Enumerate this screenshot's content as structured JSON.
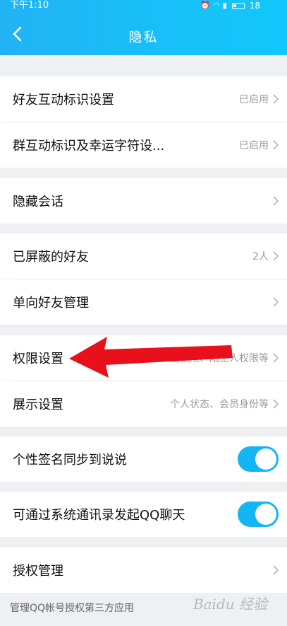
{
  "status_bar": {
    "time": "下午1:10",
    "battery": "18"
  },
  "header": {
    "title": "隐私"
  },
  "rows": [
    {
      "label": "好友互动标识设置",
      "value": "已启用"
    },
    {
      "label": "群互动标识及幸运字符设...",
      "value": "已启用"
    },
    {
      "label": "隐藏会话",
      "value": ""
    },
    {
      "label": "已屏蔽的好友",
      "value": "2人"
    },
    {
      "label": "单向好友管理",
      "value": ""
    },
    {
      "label": "权限设置",
      "value": "...区权限、陌生人权限等"
    },
    {
      "label": "展示设置",
      "value": "个人状态、会员身份等"
    },
    {
      "label": "个性签名同步到说说",
      "toggle": true
    },
    {
      "label": "可通过系统通讯录发起QQ聊天",
      "toggle": true
    },
    {
      "label": "授权管理",
      "value": ""
    }
  ],
  "footnote": "管理QQ帐号授权第三方应用",
  "watermark": "Baidu 经验",
  "colors": {
    "header": "#17c0f8",
    "toggle_on": "#13b6f2",
    "arrow": "#e8101a"
  }
}
